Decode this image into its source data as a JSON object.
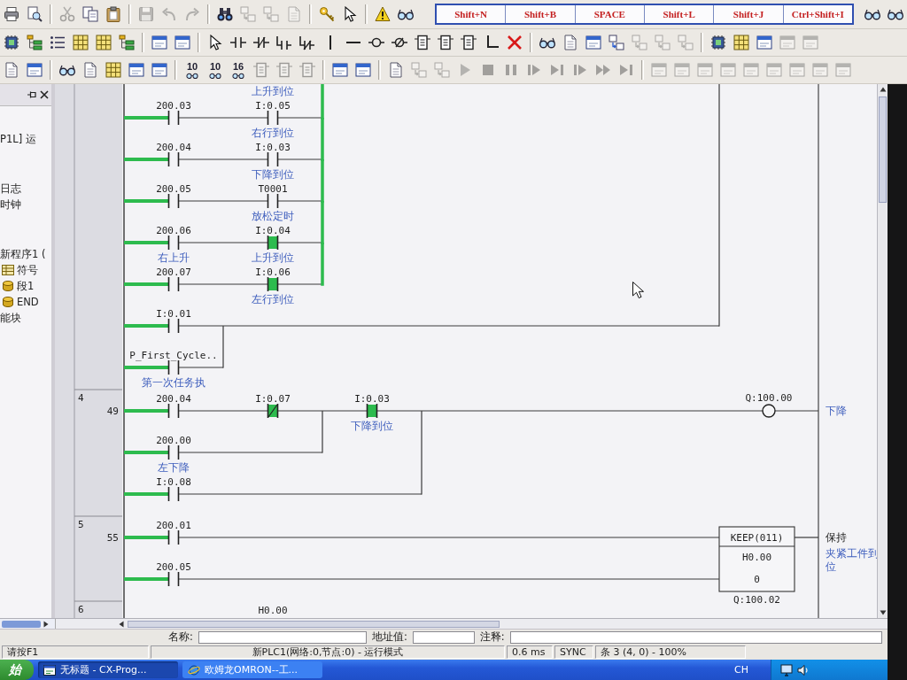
{
  "toolbars": [
    {
      "items": [
        {
          "kind": "printer",
          "disabled": false
        },
        {
          "kind": "preview",
          "disabled": false
        },
        {
          "kind": "separator"
        },
        {
          "kind": "scissors",
          "disabled": true
        },
        {
          "kind": "copy",
          "disabled": false
        },
        {
          "kind": "clipboard",
          "disabled": false
        },
        {
          "kind": "separator"
        },
        {
          "kind": "disk",
          "disabled": true
        },
        {
          "kind": "undo",
          "disabled": true
        },
        {
          "kind": "redo",
          "disabled": true
        },
        {
          "kind": "separator"
        },
        {
          "kind": "binoculars",
          "disabled": false
        },
        {
          "kind": "swap",
          "disabled": true
        },
        {
          "kind": "swap",
          "disabled": true
        },
        {
          "kind": "page",
          "disabled": true
        },
        {
          "kind": "separator"
        },
        {
          "kind": "key",
          "disabled": false
        },
        {
          "kind": "pointer",
          "disabled": false
        },
        {
          "kind": "separator"
        },
        {
          "kind": "warning",
          "disabled": false
        },
        {
          "kind": "glasses",
          "disabled": false
        },
        {
          "kind": "shortcuts",
          "keys": [
            "Shift+N",
            "Shift+B",
            "SPACE",
            "Shift+L",
            "Shift+J",
            "Ctrl+Shift+I"
          ]
        },
        {
          "kind": "glasses",
          "disabled": false
        },
        {
          "kind": "glasses",
          "disabled": false
        }
      ]
    },
    {
      "items": [
        {
          "kind": "chip",
          "disabled": false
        },
        {
          "kind": "tree",
          "disabled": false
        },
        {
          "kind": "list",
          "disabled": false
        },
        {
          "kind": "grid",
          "disabled": false
        },
        {
          "kind": "grid",
          "disabled": false
        },
        {
          "kind": "tree",
          "disabled": false
        },
        {
          "kind": "separator"
        },
        {
          "kind": "window",
          "disabled": false
        },
        {
          "kind": "window",
          "disabled": false
        },
        {
          "kind": "separator"
        },
        {
          "kind": "pointer",
          "disabled": false
        },
        {
          "kind": "contact",
          "disabled": false
        },
        {
          "kind": "contact_nc",
          "disabled": false
        },
        {
          "kind": "contact_or",
          "disabled": false
        },
        {
          "kind": "contact_or_nc",
          "disabled": false
        },
        {
          "kind": "vline",
          "disabled": false
        },
        {
          "kind": "hline",
          "disabled": false
        },
        {
          "kind": "coil",
          "disabled": false
        },
        {
          "kind": "coil_nc",
          "disabled": false
        },
        {
          "kind": "function",
          "disabled": false
        },
        {
          "kind": "function",
          "disabled": false
        },
        {
          "kind": "function",
          "disabled": false
        },
        {
          "kind": "corner",
          "disabled": false
        },
        {
          "kind": "delete",
          "disabled": false
        },
        {
          "kind": "separator"
        },
        {
          "kind": "glasses",
          "disabled": false
        },
        {
          "kind": "page",
          "disabled": false
        },
        {
          "kind": "window",
          "disabled": false
        },
        {
          "kind": "swap",
          "disabled": false
        },
        {
          "kind": "swap",
          "disabled": true
        },
        {
          "kind": "swap",
          "disabled": true
        },
        {
          "kind": "swap",
          "disabled": true
        },
        {
          "kind": "separator"
        },
        {
          "kind": "chip",
          "disabled": false
        },
        {
          "kind": "grid",
          "disabled": false
        },
        {
          "kind": "window",
          "disabled": false
        },
        {
          "kind": "window",
          "disabled": true
        },
        {
          "kind": "window",
          "disabled": true
        }
      ]
    },
    {
      "items": [
        {
          "kind": "page",
          "disabled": false
        },
        {
          "kind": "window",
          "disabled": false
        },
        {
          "kind": "separator"
        },
        {
          "kind": "glasses",
          "disabled": false
        },
        {
          "kind": "page",
          "disabled": false
        },
        {
          "kind": "grid",
          "disabled": false
        },
        {
          "kind": "window",
          "disabled": false
        },
        {
          "kind": "window",
          "disabled": false
        },
        {
          "kind": "separator"
        },
        {
          "kind": "number",
          "label": "10",
          "disabled": false
        },
        {
          "kind": "number",
          "label": "10",
          "disabled": false
        },
        {
          "kind": "number",
          "label": "16",
          "disabled": false
        },
        {
          "kind": "function",
          "disabled": true
        },
        {
          "kind": "function",
          "disabled": true
        },
        {
          "kind": "function",
          "disabled": true
        },
        {
          "kind": "separator"
        },
        {
          "kind": "window",
          "disabled": false
        },
        {
          "kind": "window",
          "disabled": false
        },
        {
          "kind": "separator"
        },
        {
          "kind": "page",
          "disabled": false
        },
        {
          "kind": "swap",
          "disabled": true
        },
        {
          "kind": "swap",
          "disabled": true
        },
        {
          "kind": "play",
          "disabled": true
        },
        {
          "kind": "stop",
          "disabled": true
        },
        {
          "kind": "pause",
          "disabled": true
        },
        {
          "kind": "step",
          "disabled": true
        },
        {
          "kind": "skip",
          "disabled": true
        },
        {
          "kind": "step",
          "disabled": true
        },
        {
          "kind": "ff",
          "disabled": true
        },
        {
          "kind": "skip",
          "disabled": true
        },
        {
          "kind": "separator"
        },
        {
          "kind": "window",
          "disabled": true
        },
        {
          "kind": "window",
          "disabled": true
        },
        {
          "kind": "window",
          "disabled": true
        },
        {
          "kind": "window",
          "disabled": true
        },
        {
          "kind": "window",
          "disabled": true
        },
        {
          "kind": "window",
          "disabled": true
        },
        {
          "kind": "window",
          "disabled": true
        },
        {
          "kind": "window",
          "disabled": true
        },
        {
          "kind": "window",
          "disabled": true
        }
      ]
    }
  ],
  "project_tree": {
    "items": [
      {
        "label": "P1L] 运"
      },
      {
        "label": "日志"
      },
      {
        "label": "时钟"
      },
      {
        "label": "新程序1 (",
        "children": [
          {
            "label": "符号",
            "kind": "symbols"
          },
          {
            "label": "段1",
            "kind": "section"
          },
          {
            "label": "END",
            "kind": "section"
          }
        ]
      },
      {
        "label": "能块"
      }
    ]
  },
  "ladder": {
    "rungs": [
      {
        "rows": [
          {
            "elements": [
              {
                "kind": "comment",
                "comment": "上升到位"
              }
            ]
          },
          {
            "powered": true,
            "elements": [
              {
                "kind": "contact",
                "address": "200.03",
                "on": false
              },
              {
                "kind": "contact",
                "address": "I:0.05",
                "comment": "右行到位",
                "on": false
              }
            ]
          },
          {
            "powered": true,
            "elements": [
              {
                "kind": "contact",
                "address": "200.04",
                "on": false
              },
              {
                "kind": "contact",
                "address": "I:0.03",
                "comment": "下降到位",
                "on": false
              }
            ]
          },
          {
            "powered": true,
            "elements": [
              {
                "kind": "contact",
                "address": "200.05",
                "on": false
              },
              {
                "kind": "contact",
                "address": "T0001",
                "comment": "放松定时",
                "on": false
              }
            ]
          },
          {
            "powered": true,
            "elements": [
              {
                "kind": "contact",
                "address": "200.06",
                "comment": "右上升",
                "on": false
              },
              {
                "kind": "contact",
                "address": "I:0.04",
                "comment": "上升到位",
                "on": true
              }
            ]
          },
          {
            "powered": true,
            "elements": [
              {
                "kind": "contact",
                "address": "200.07",
                "on": false
              },
              {
                "kind": "contact",
                "address": "I:0.06",
                "comment": "左行到位",
                "on": true
              }
            ]
          },
          {
            "powered": true,
            "elements": [
              {
                "kind": "contact",
                "address": "I:0.01",
                "on": false
              }
            ]
          },
          {
            "powered": true,
            "elements": [
              {
                "kind": "contact",
                "address": "P_First_Cycle..",
                "comment": "第一次任务执",
                "on": false
              }
            ]
          }
        ]
      },
      {
        "number": "4",
        "step": "49",
        "rows": [
          {
            "powered": true,
            "elements": [
              {
                "kind": "contact",
                "address": "200.04",
                "on": false
              },
              {
                "kind": "contact_nc",
                "address": "I:0.07",
                "on": true
              },
              {
                "kind": "contact",
                "address": "I:0.03",
                "comment": "下降到位",
                "on": true
              },
              {
                "kind": "coil",
                "address": "Q:100.00",
                "comment": "下降",
                "on": false
              }
            ]
          },
          {
            "powered": true,
            "elements": [
              {
                "kind": "contact",
                "address": "200.00",
                "comment": "左下降",
                "on": false
              }
            ]
          },
          {
            "powered": true,
            "elements": [
              {
                "kind": "contact",
                "address": "I:0.08",
                "on": false
              }
            ]
          }
        ]
      },
      {
        "number": "5",
        "step": "55",
        "rows": [
          {
            "powered": true,
            "elements": [
              {
                "kind": "contact",
                "address": "200.01",
                "on": false
              },
              {
                "kind": "keep",
                "lines": [
                  "KEEP(011)",
                  "H0.00",
                  "0"
                ],
                "operand": "Q:100.02",
                "description": "保持",
                "comment": "夹紧工件到位"
              }
            ]
          },
          {
            "powered": true,
            "elements": [
              {
                "kind": "contact",
                "address": "200.05",
                "on": false
              }
            ]
          }
        ]
      },
      {
        "number": "6",
        "rows": [
          {
            "elements": [
              {
                "kind": "label",
                "address": "H0.00"
              }
            ]
          }
        ]
      }
    ]
  },
  "symbol_bar": {
    "fields": [
      {
        "label": "名称:"
      },
      {
        "label": "地址值:"
      },
      {
        "label": "注释:"
      }
    ]
  },
  "status_bar": {
    "panes": [
      "请按F1",
      "新PLC1(网络:0,节点:0) - 运行模式",
      "0.6 ms",
      "SYNC",
      "条 3 (4, 0) - 100%"
    ]
  },
  "taskbar": {
    "start": "始",
    "tasks": [
      {
        "label": "无标题 - CX-Prog...",
        "kind": "app",
        "selected": true
      },
      {
        "label": "欧姆龙OMRON--工...",
        "kind": "browser",
        "selected": false
      }
    ],
    "language": "CH"
  }
}
